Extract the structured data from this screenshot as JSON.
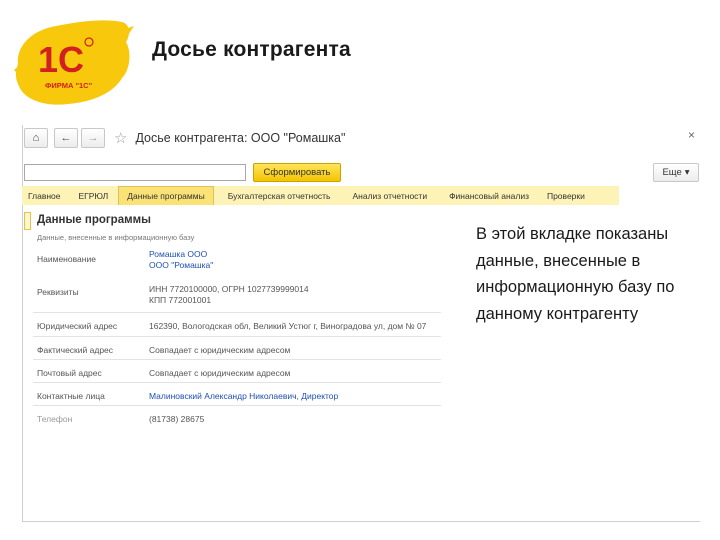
{
  "slide": {
    "title": "Досье контрагента",
    "logo_text": "ФИРМА \"1С\""
  },
  "window": {
    "title": "Досье контрагента: ООО \"Ромашка\"",
    "close_glyph": "×"
  },
  "toolbar": {
    "home_glyph": "⌂",
    "back_glyph": "←",
    "forward_glyph": "→",
    "favorite_glyph": "☆"
  },
  "search": {
    "value": "",
    "placeholder": "",
    "submit_label": "Сформировать",
    "more_label": "Еще",
    "more_arrow": "▾"
  },
  "tabs": [
    {
      "label": "Главное"
    },
    {
      "label": "ЕГРЮЛ"
    },
    {
      "label": "Данные программы"
    },
    {
      "label": "Бухгалтерская отчетность"
    },
    {
      "label": "Анализ отчетности"
    },
    {
      "label": "Финансовый анализ"
    },
    {
      "label": "Проверки"
    }
  ],
  "active_tab": "Данные программы",
  "section": {
    "title": "Данные программы",
    "subtitle": "Данные, внесенные в информационную базу"
  },
  "rows": [
    {
      "label": "Наименование",
      "value_lines": [
        "Ромашка ООО",
        "ООО \"Ромашка\""
      ]
    },
    {
      "label": "Реквизиты",
      "value_lines": [
        "ИНН 7720100000, ОГРН 1027739999014",
        "КПП 772001001"
      ]
    },
    {
      "label": "Юридический адрес",
      "value_lines": [
        "162390, Вологодская обл, Великий Устюг г, Виноградова ул, дом № 07"
      ]
    },
    {
      "label": "Фактический адрес",
      "value_lines": [
        "Совпадает с юридическим адресом"
      ]
    },
    {
      "label": "Почтовый адрес",
      "value_lines": [
        "Совпадает с юридическим адресом"
      ]
    },
    {
      "label": "Контактные лица",
      "value_lines": [
        "Малиновский Александр Николаевич, Директор"
      ]
    },
    {
      "label": "Телефон",
      "value_lines": [
        "(81738) 28675"
      ]
    }
  ],
  "callout": {
    "text": "В этой вкладке показаны данные, внесенные в информационную базу по данному контрагенту"
  },
  "colors": {
    "accent_yellow": "#f5c400",
    "tab_bar": "#fdf3b6",
    "active_tab": "#fbe277",
    "link": "#1f4fb0",
    "logo_red": "#d21f1f"
  }
}
